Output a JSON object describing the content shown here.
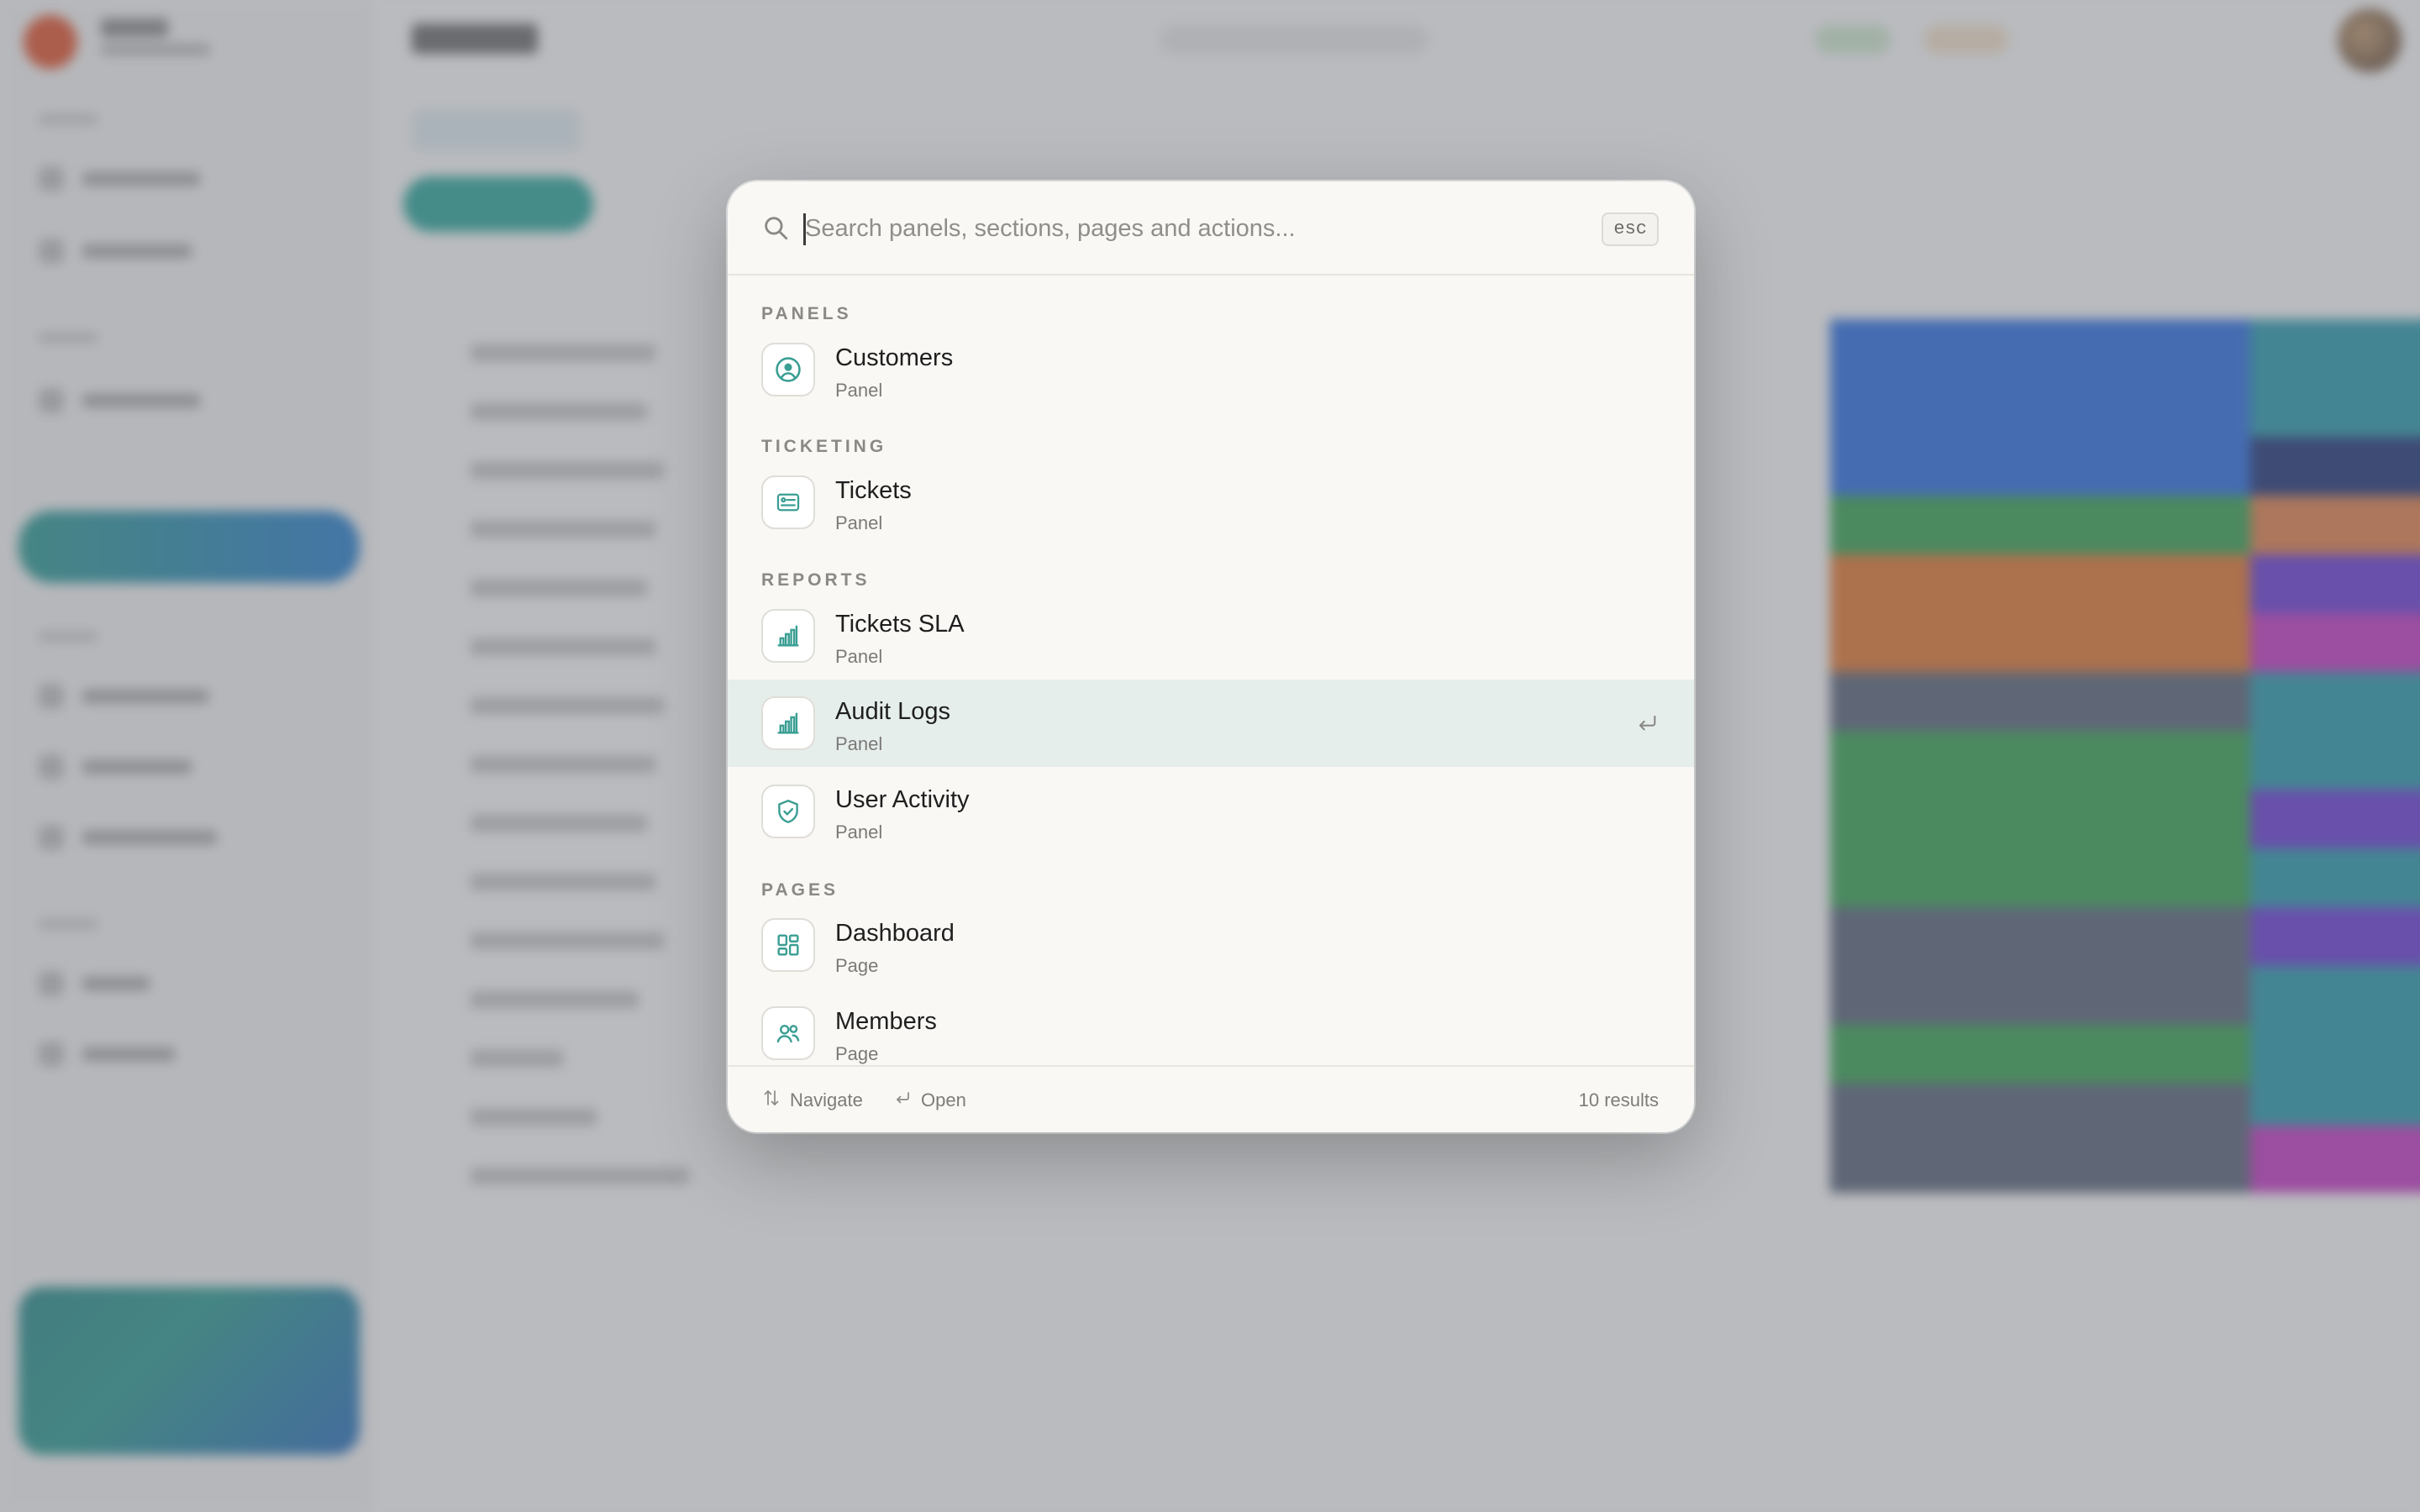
{
  "palette": {
    "search": {
      "placeholder": "Search panels, sections, pages and actions...",
      "value": ""
    },
    "esc_label": "esc",
    "groups": [
      {
        "label": "PANELS",
        "items": [
          {
            "title": "Customers",
            "subtitle": "Panel",
            "icon": "user-circle-icon",
            "selected": false
          }
        ]
      },
      {
        "label": "TICKETING",
        "items": [
          {
            "title": "Tickets",
            "subtitle": "Panel",
            "icon": "ticket-card-icon",
            "selected": false
          }
        ]
      },
      {
        "label": "REPORTS",
        "items": [
          {
            "title": "Tickets SLA",
            "subtitle": "Panel",
            "icon": "bar-chart-icon",
            "selected": false
          },
          {
            "title": "Audit Logs",
            "subtitle": "Panel",
            "icon": "bar-chart-icon",
            "selected": true
          },
          {
            "title": "User Activity",
            "subtitle": "Panel",
            "icon": "shield-check-icon",
            "selected": false
          }
        ]
      },
      {
        "label": "PAGES",
        "items": [
          {
            "title": "Dashboard",
            "subtitle": "Page",
            "icon": "dashboard-grid-icon",
            "selected": false
          },
          {
            "title": "Members",
            "subtitle": "Page",
            "icon": "users-icon",
            "selected": false
          }
        ]
      }
    ],
    "footer": {
      "navigate_label": "Navigate",
      "open_label": "Open",
      "results_count": "10 results"
    }
  },
  "colors": {
    "accent": "#3a9e93",
    "selected_row": "#e6eeec",
    "palette_bg": "#f9f8f4"
  }
}
